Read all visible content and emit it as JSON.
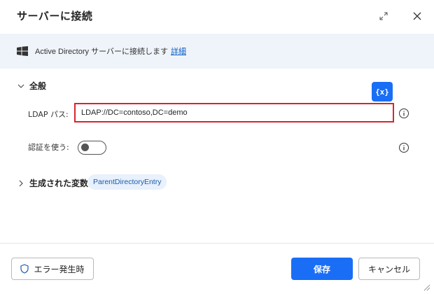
{
  "dialog": {
    "title": "サーバーに接続",
    "expand_icon": "expand-icon",
    "close_icon": "close-icon"
  },
  "banner": {
    "icon": "windows-icon",
    "text": "Active Directory サーバーに接続します",
    "link": "詳細"
  },
  "general": {
    "section_label": "全般",
    "variable_button": "{x}",
    "ldap_label": "LDAP パス:",
    "ldap_value": "LDAP://DC=contoso,DC=demo",
    "auth_label": "認証を使う:",
    "auth_enabled": false
  },
  "variables": {
    "section_label": "生成された変数",
    "items": [
      "ParentDirectoryEntry"
    ]
  },
  "footer": {
    "error_button": "エラー発生時",
    "save_button": "保存",
    "cancel_button": "キャンセル"
  },
  "colors": {
    "accent": "#1a6ef5",
    "input_border_error": "#d7262d",
    "banner_bg": "#eff4fa"
  }
}
